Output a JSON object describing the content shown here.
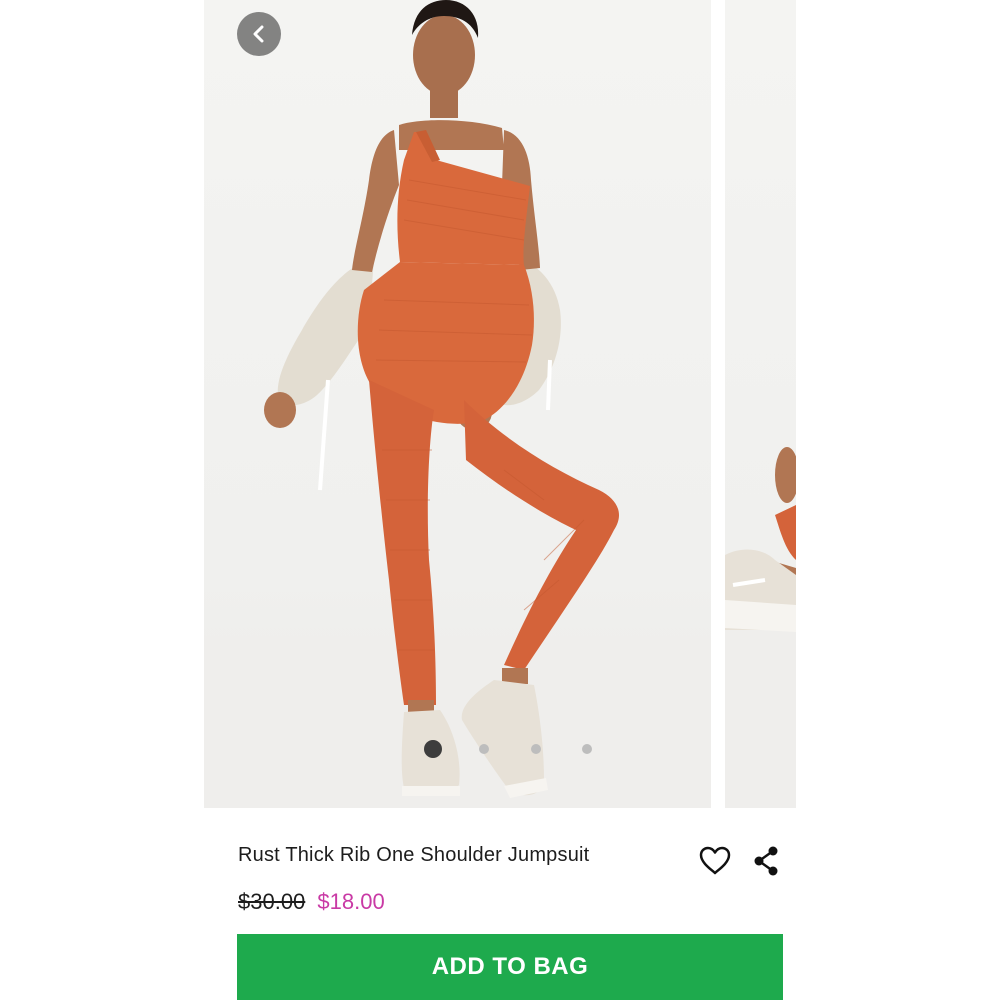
{
  "product": {
    "title": "Rust Thick Rib One Shoulder Jumpsuit",
    "price_original": "$30.00",
    "price_sale": "$18.00",
    "add_to_bag_label": "ADD TO BAG"
  },
  "gallery": {
    "image_count": 4,
    "active_index": 0
  },
  "icons": {
    "back": "chevron-left-icon",
    "wishlist": "heart-outline-icon",
    "share": "share-icon"
  },
  "colors": {
    "add_to_bag": "#1eaa4d",
    "sale_price": "#c93aa5",
    "text": "#1d1d1d",
    "dot_active": "#3d3d3d",
    "dot_inactive": "#bdbdbd"
  }
}
